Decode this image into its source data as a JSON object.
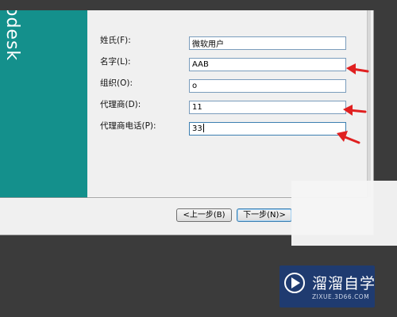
{
  "panel": {
    "brand": "odesk"
  },
  "form": {
    "fields": [
      {
        "label": "姓氏(F):",
        "value": "微软用户"
      },
      {
        "label": "名字(L):",
        "value": "AAB"
      },
      {
        "label": "组织(O):",
        "value": "o"
      },
      {
        "label": "代理商(D):",
        "value": "11"
      },
      {
        "label": "代理商电话(P):",
        "value": "33"
      }
    ]
  },
  "buttons": {
    "back": "<上一步(B)",
    "next": "下一步(N)>"
  },
  "watermark": {
    "title": "溜溜自学",
    "subtitle": "ZIXUE.3D66.COM"
  },
  "colors": {
    "panel": "#14908c",
    "arrow": "#e02020",
    "watermark": "#1f3b70"
  }
}
